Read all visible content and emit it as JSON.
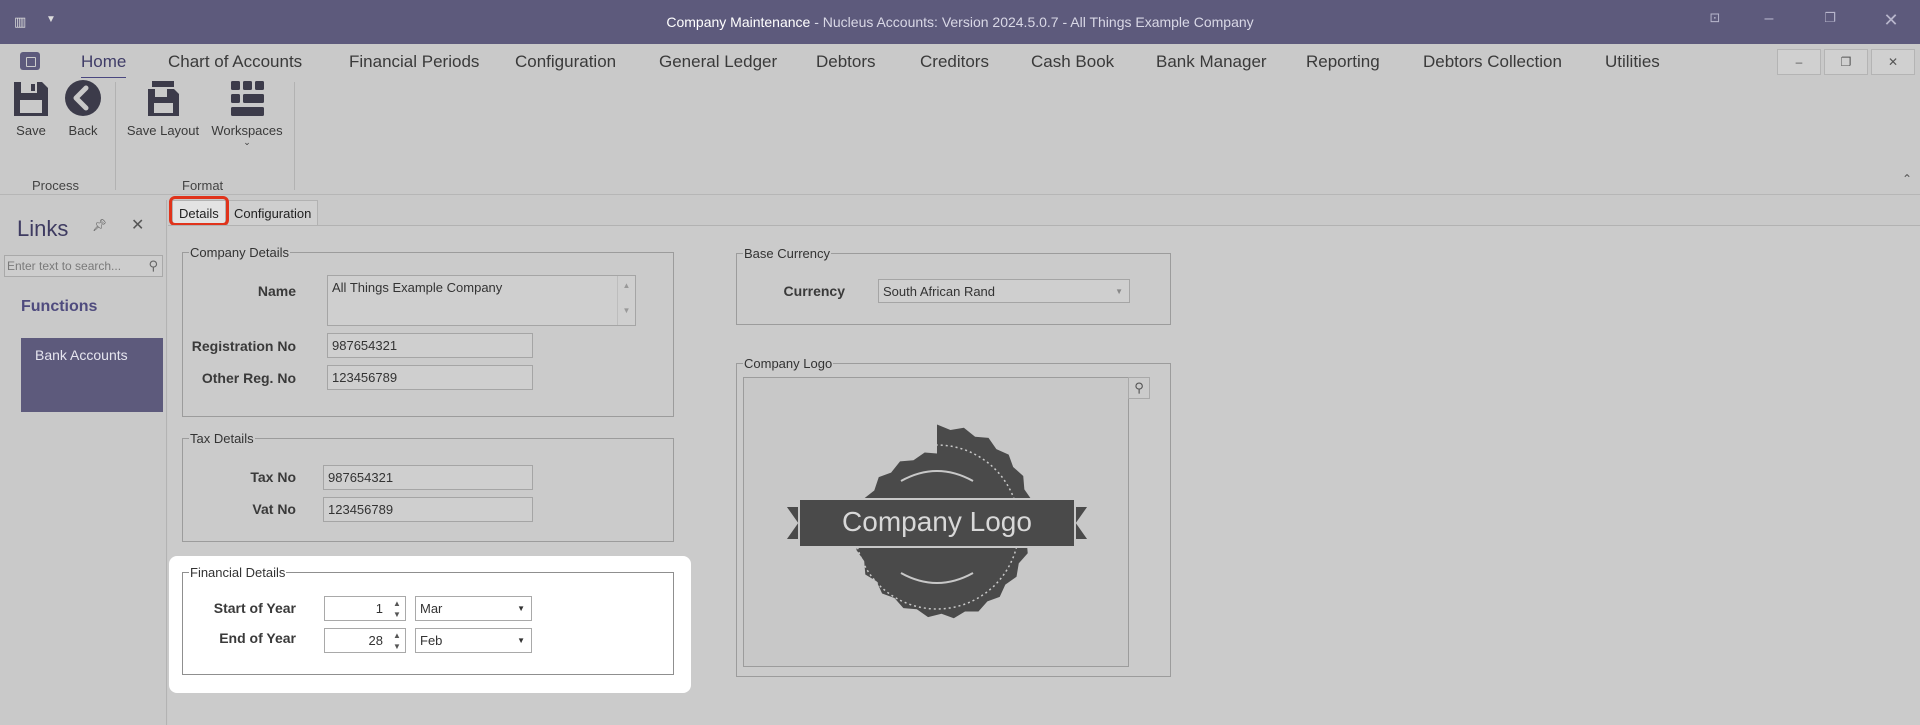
{
  "window": {
    "title_main": "Company Maintenance",
    "title_rest": " - Nucleus Accounts: Version 2024.5.0.7 - All Things Example Company"
  },
  "menu": {
    "items": [
      "Home",
      "Chart of Accounts",
      "Financial Periods",
      "Configuration",
      "General Ledger",
      "Debtors",
      "Creditors",
      "Cash Book",
      "Bank Manager",
      "Reporting",
      "Debtors Collection",
      "Utilities"
    ]
  },
  "ribbon": {
    "save": "Save",
    "back": "Back",
    "save_layout": "Save Layout",
    "workspaces": "Workspaces",
    "group_process": "Process",
    "group_format": "Format"
  },
  "links": {
    "title": "Links",
    "search_placeholder": "Enter text to search...",
    "functions": "Functions",
    "bank_accounts": "Bank Accounts"
  },
  "tabs": [
    "Details",
    "Configuration"
  ],
  "company": {
    "legend": "Company Details",
    "name_label": "Name",
    "name_value": "All Things Example Company",
    "reg_label": "Registration No",
    "reg_value": "987654321",
    "other_label": "Other Reg. No",
    "other_value": "123456789"
  },
  "tax": {
    "legend": "Tax Details",
    "tax_label": "Tax No",
    "tax_value": "987654321",
    "vat_label": "Vat No",
    "vat_value": "123456789"
  },
  "financial": {
    "legend": "Financial Details",
    "start_label": "Start of Year",
    "start_day": "1",
    "start_month": "Mar",
    "end_label": "End of Year",
    "end_day": "28",
    "end_month": "Feb"
  },
  "currency": {
    "legend": "Base Currency",
    "label": "Currency",
    "value": "South African Rand"
  },
  "logo": {
    "legend": "Company Logo",
    "image_text": "Company Logo"
  },
  "colors": {
    "accent": "#5d5a7c",
    "highlight": "#e0331b"
  }
}
